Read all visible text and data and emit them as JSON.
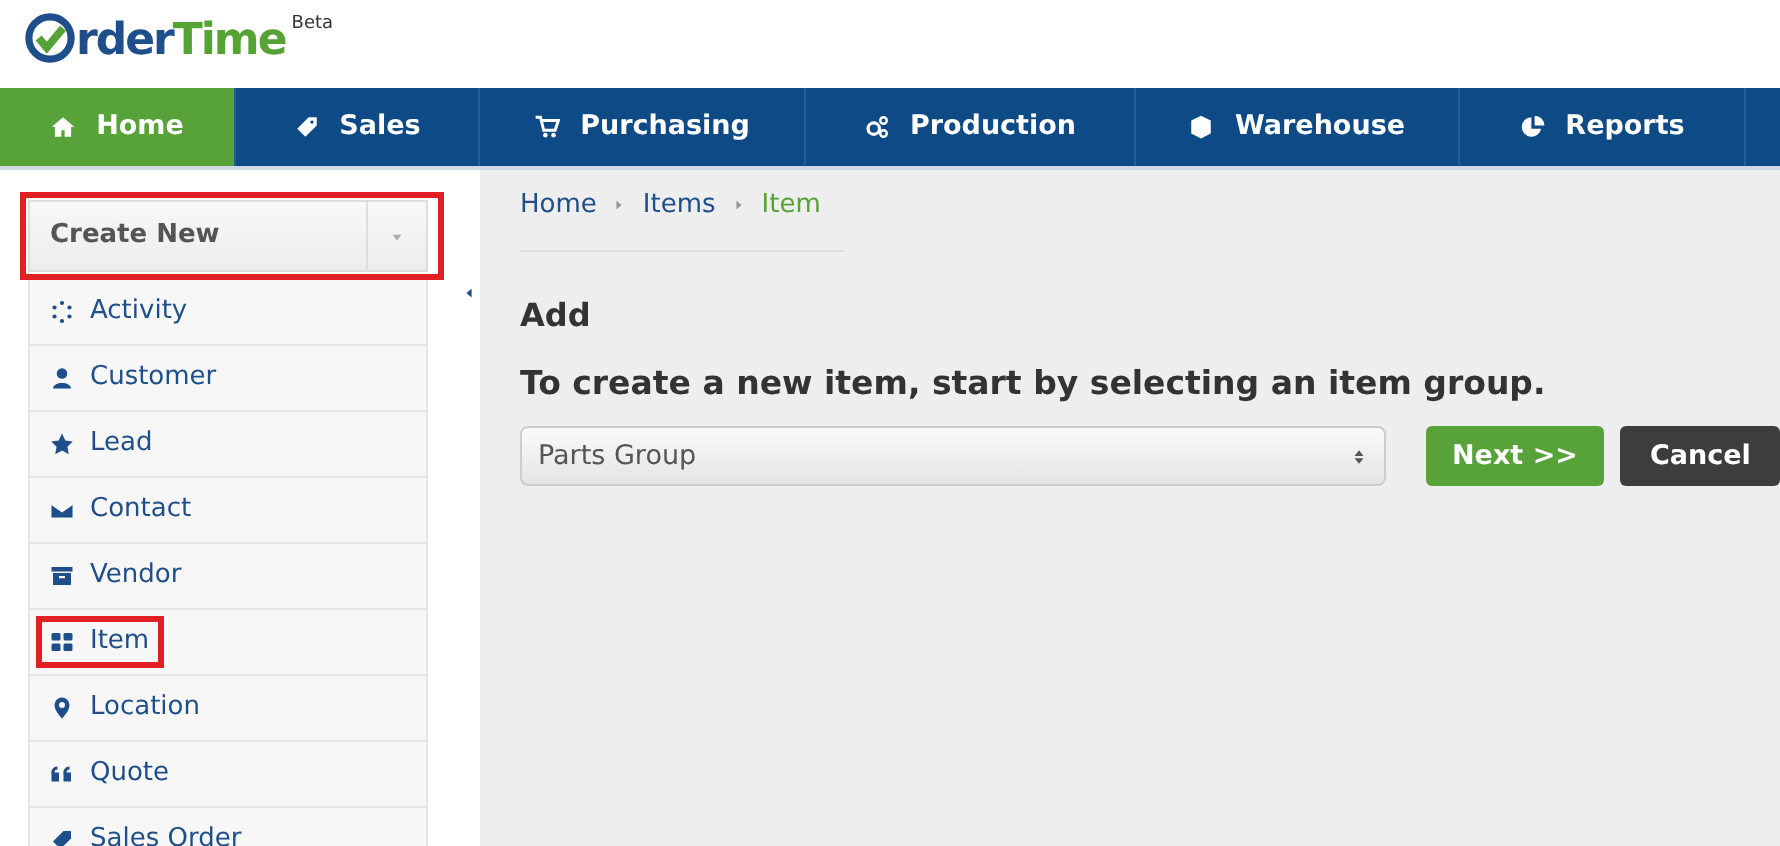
{
  "logo": {
    "part1": "rder",
    "part2": "Time",
    "badge": "Beta"
  },
  "nav": [
    {
      "label": "Home",
      "selected": true
    },
    {
      "label": "Sales",
      "selected": false
    },
    {
      "label": "Purchasing",
      "selected": false
    },
    {
      "label": "Production",
      "selected": false
    },
    {
      "label": "Warehouse",
      "selected": false
    },
    {
      "label": "Reports",
      "selected": false
    }
  ],
  "sidebar": {
    "create_new": {
      "label": "Create New",
      "highlighted": true
    },
    "items": [
      {
        "label": "Activity",
        "highlighted": false
      },
      {
        "label": "Customer",
        "highlighted": false
      },
      {
        "label": "Lead",
        "highlighted": false
      },
      {
        "label": "Contact",
        "highlighted": false
      },
      {
        "label": "Vendor",
        "highlighted": false
      },
      {
        "label": "Item",
        "highlighted": true
      },
      {
        "label": "Location",
        "highlighted": false
      },
      {
        "label": "Quote",
        "highlighted": false
      },
      {
        "label": "Sales Order",
        "highlighted": false
      }
    ]
  },
  "breadcrumb": [
    {
      "label": "Home",
      "selected": false
    },
    {
      "label": "Items",
      "selected": false
    },
    {
      "label": "Item",
      "selected": true
    }
  ],
  "heading": "Add",
  "prompt": "To create a new item, start by selecting an item group.",
  "item_group_select": {
    "value": "Parts Group"
  },
  "buttons": [
    {
      "label": "Next >>",
      "kind": "primary"
    },
    {
      "label": "Cancel",
      "kind": "secondary"
    }
  ]
}
